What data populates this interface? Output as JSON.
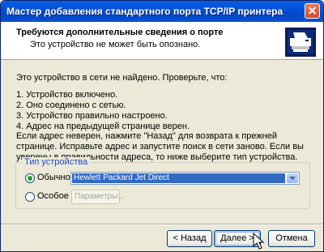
{
  "window": {
    "title": "Мастер добавления стандартного порта TCP/IP принтера"
  },
  "header": {
    "title": "Требуются дополнительные сведения о порте",
    "subtitle": "Это устройство не может быть опознано."
  },
  "content": {
    "intro": "Это устройство в сети не найдено. Проверьте, что:",
    "checklist": [
      "1.  Устройство включено.",
      "2.  Оно соединено с сетью.",
      "3.  Устройство правильно настроено.",
      "4.  Адрес на предыдущей странице верен."
    ],
    "paragraph": "Если адрес неверен, нажмите \"Назад\" для возврата к прежней странице.  Исправьте адрес и запустите поиск в сети заново.  Если вы уверены в правильности адреса, то ниже выберите тип устройства."
  },
  "device_type": {
    "legend": "Тип устройства",
    "standard_label": "Обычное",
    "standard_selected": true,
    "standard_value": "Hewlett Packard Jet Direct",
    "custom_label": "Особое",
    "custom_selected": false,
    "params_label": "Параметры..."
  },
  "buttons": {
    "back": "< Назад",
    "next": "Далее >",
    "cancel": "Отмена"
  },
  "icons": {
    "close": "close-icon",
    "printer": "printer-icon",
    "dropdown": "chevron-down-icon",
    "cursor": "mouse-pointer-icon"
  }
}
